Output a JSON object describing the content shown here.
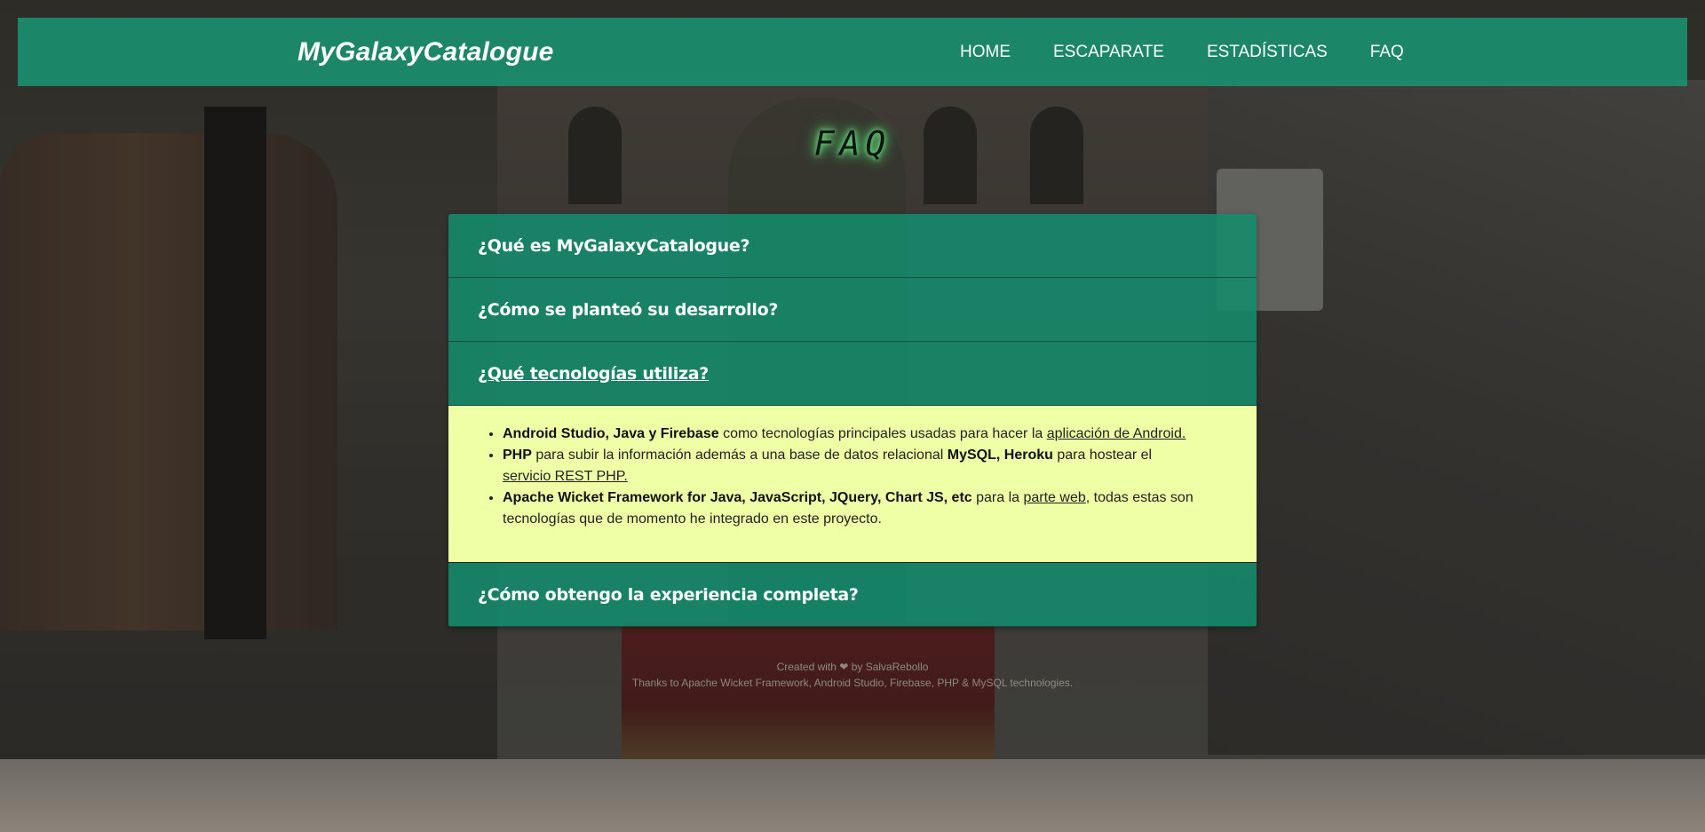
{
  "navbar": {
    "brand": "MyGalaxyCatalogue",
    "links": [
      "HOME",
      "ESCAPARATE",
      "ESTADÍSTICAS",
      "FAQ"
    ]
  },
  "page_title": "FAQ",
  "faq": [
    {
      "question": "¿Qué es MyGalaxyCatalogue?",
      "expanded": false
    },
    {
      "question": "¿Cómo se planteó su desarrollo?",
      "expanded": false
    },
    {
      "question": "¿Qué tecnologías utiliza?",
      "expanded": true
    },
    {
      "question": "¿Cómo obtengo la experiencia completa?",
      "expanded": false
    }
  ],
  "answer": {
    "item1": {
      "bold": "Android Studio, Java y Firebase",
      "text": " como tecnologías principales usadas para hacer la ",
      "link": "aplicación de Android."
    },
    "item2": {
      "bold1": "PHP",
      "text1": " para subir la información además a una base de datos relacional ",
      "bold2": "MySQL, Heroku",
      "text2": " para hostear el ",
      "link": "servicio REST PHP."
    },
    "item3": {
      "bold": "Apache Wicket Framework for Java, JavaScript, JQuery, Chart JS, etc",
      "text1": " para la ",
      "link": "parte web",
      "text2": ", todas estas son tecnologías que de momento he integrado en este proyecto."
    }
  },
  "footer": {
    "line1_prefix": "Created with",
    "heart": "❤",
    "line1_suffix": "by SalvaRebollo",
    "line2": "Thanks to Apache Wicket Framework, Android Studio, Firebase, PHP & MySQL technologies."
  },
  "colors": {
    "navbar": "#179673",
    "accordion_header": "#148c6c",
    "answer_bg": "#eeffa6"
  }
}
